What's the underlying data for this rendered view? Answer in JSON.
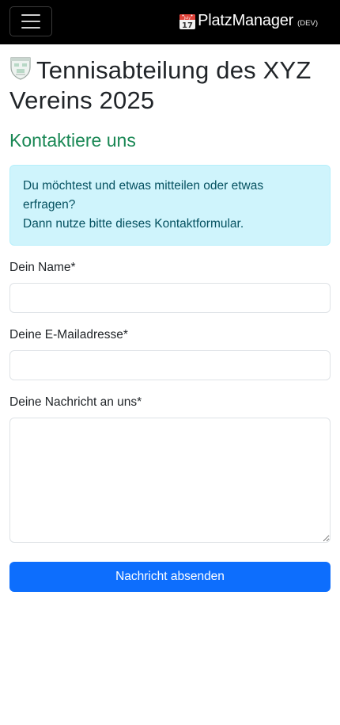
{
  "navbar": {
    "brand_name": "PlatzManager",
    "brand_tag": "(DEV)",
    "brand_icon": "calendar-icon",
    "menu_icon": "hamburger-menu-icon",
    "calendar_month": "July",
    "calendar_day": "17"
  },
  "page": {
    "title": "Tennisabteilung des XYZ Vereins 2025",
    "crest_icon": "club-crest-icon",
    "subtitle": "Kontaktiere uns"
  },
  "alert": {
    "line1": "Du möchtest und etwas mitteilen oder etwas erfragen?",
    "line2": "Dann nutze bitte dieses Kontaktformular."
  },
  "form": {
    "name_label": "Dein Name*",
    "name_value": "",
    "email_label": "Deine E-Mailadresse*",
    "email_value": "",
    "message_label": "Deine Nachricht an uns*",
    "message_value": "",
    "submit_label": "Nachricht absenden"
  },
  "colors": {
    "navbar_bg": "#000000",
    "subtitle": "#198754",
    "alert_bg": "#cff4fc",
    "alert_text": "#055160",
    "button_bg": "#0d6efd"
  }
}
